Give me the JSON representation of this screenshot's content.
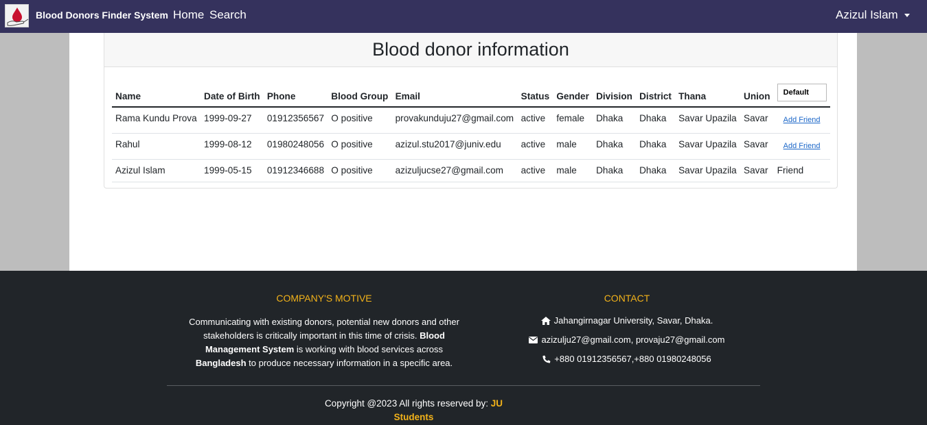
{
  "navbar": {
    "brand": "Blood Donors Finder System",
    "home": "Home",
    "search": "Search",
    "user": "Azizul Islam",
    "bg": "#35325d"
  },
  "card": {
    "title": "Blood donor information"
  },
  "table": {
    "headers": [
      "Name",
      "Date of Birth",
      "Phone",
      "Blood Group",
      "Email",
      "Status",
      "Gender",
      "Division",
      "District",
      "Thana",
      "Union"
    ],
    "filter_value": "Default",
    "rows": [
      {
        "name": "Rama Kundu Prova",
        "dob": "1999-09-27",
        "phone": "01912356567",
        "blood": "O positive",
        "email": "provakunduju27@gmail.com",
        "status": "active",
        "gender": "female",
        "division": "Dhaka",
        "district": "Dhaka",
        "thana": "Savar Upazila",
        "union": "Savar",
        "action": "Add Friend"
      },
      {
        "name": "Rahul",
        "dob": "1999-08-12",
        "phone": "01980248056",
        "blood": "O positive",
        "email": "azizul.stu2017@juniv.edu",
        "status": "active",
        "gender": "male",
        "division": "Dhaka",
        "district": "Dhaka",
        "thana": "Savar Upazila",
        "union": "Savar",
        "action": "Add Friend"
      },
      {
        "name": "Azizul Islam",
        "dob": "1999-05-15",
        "phone": "01912346688",
        "blood": "O positive",
        "email": "azizuljucse27@gmail.com",
        "status": "active",
        "gender": "male",
        "division": "Dhaka",
        "district": "Dhaka",
        "thana": "Savar Upazila",
        "union": "Savar",
        "action": "Friend"
      }
    ]
  },
  "footer": {
    "motive_heading": "COMPANY'S MOTIVE",
    "motive_text_1": "Communicating with existing donors, potential new donors and other stakeholders is critically important in this time of crisis.",
    "motive_bold_1": "Blood Management System",
    "motive_text_2": "is working with blood services across",
    "motive_bold_2": "Bangladesh",
    "motive_text_3": "to produce necessary information in a specific area.",
    "contact_heading": "CONTACT",
    "address": "Jahangirnagar University, Savar, Dhaka.",
    "emails": "azizulju27@gmail.com, provaju27@gmail.com",
    "phones": "+880 01912356567,+880 01980248056",
    "copyright": "Copyright @2023 All rights reserved by:",
    "copyright_by": "JU Students",
    "accent": "#f2b21a"
  }
}
